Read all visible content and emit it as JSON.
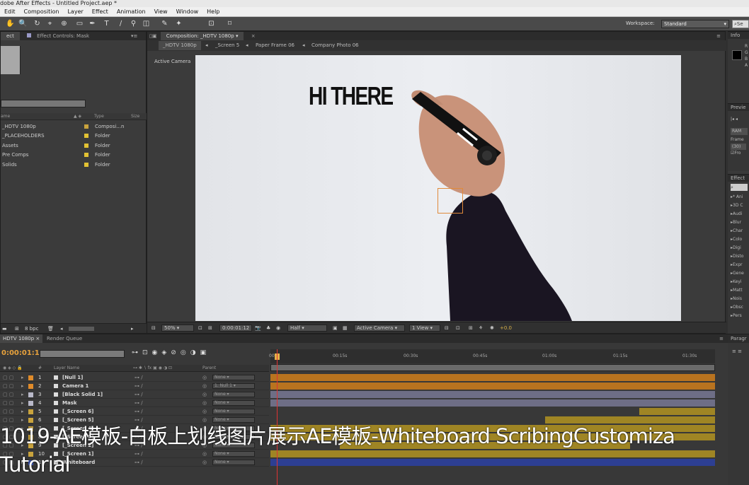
{
  "window": {
    "title": "dobe After Effects - Untitled Project.aep *"
  },
  "menu": [
    "Edit",
    "Composition",
    "Layer",
    "Effect",
    "Animation",
    "View",
    "Window",
    "Help"
  ],
  "toolbar": {
    "workspace_label": "Workspace:",
    "workspace_value": "Standard",
    "search_placeholder": "Se"
  },
  "project_panel": {
    "tabs": [
      "ect",
      "Effect Controls: Mask"
    ],
    "columns": [
      "ame",
      "Type",
      "Size"
    ],
    "items": [
      {
        "name": "_HDTV 1080p",
        "type": "Composi...n",
        "color": "#c9a33d"
      },
      {
        "name": "_PLACEHOLDERS",
        "type": "Folder",
        "color": "#e2c233"
      },
      {
        "name": "Assets",
        "type": "Folder",
        "color": "#e2c233"
      },
      {
        "name": "Pre Comps",
        "type": "Folder",
        "color": "#e2c233"
      },
      {
        "name": "Solids",
        "type": "Folder",
        "color": "#e2c233"
      }
    ],
    "bpc": "8 bpc"
  },
  "comp_panel": {
    "tab": "Composition: _HDTV 1080p",
    "breadcrumbs": [
      "_HDTV 1080p",
      "_Screen 5",
      "Paper Frame 06",
      "Company Photo 06"
    ],
    "view_label": "Active Camera",
    "canvas_text": "HI THERE",
    "zoom": "50%",
    "timecode": "0:00:01:12",
    "resolution": "Half",
    "camera": "Active Camera",
    "views": "1 View",
    "exposure": "+0.0"
  },
  "right_panels": {
    "info": {
      "title": "Info",
      "lines": [
        "R",
        "G",
        "B",
        "A"
      ]
    },
    "preview": {
      "title": "Previe",
      "ram": "RAM",
      "frame_label": "Frame",
      "frame_value": "(30)",
      "from_label": "Fro"
    },
    "effects": {
      "title": "Effect",
      "items": [
        "* Ani",
        "3D C",
        "Audi",
        "Blur",
        "Char",
        "Colo",
        "Digi",
        "Disto",
        "Expr",
        "Gene",
        "Keyi",
        "Matt",
        "Nois",
        "Obsc",
        "Pers"
      ]
    },
    "paragraph": {
      "title": "Paragr"
    }
  },
  "timeline": {
    "tabs": [
      "HDTV 1080p",
      "Render Queue"
    ],
    "current_time": "0:00:01:12",
    "columns": [
      "#",
      "Layer Name",
      "Parent"
    ],
    "ruler": [
      "00s",
      "00:15s",
      "00:30s",
      "00:45s",
      "01:00s",
      "01:15s",
      "01:30s"
    ],
    "layers": [
      {
        "num": "1",
        "name": "[Null 1]",
        "parent": "None",
        "color": "#e08b2a"
      },
      {
        "num": "2",
        "name": "Camera 1",
        "parent": "1. Null 1",
        "color": "#e08b2a"
      },
      {
        "num": "3",
        "name": "[Black Solid 1]",
        "parent": "None",
        "color": "#b9b9c9"
      },
      {
        "num": "4",
        "name": "Mask",
        "parent": "None",
        "color": "#b9b9c9"
      },
      {
        "num": "5",
        "name": "[_Screen 6]",
        "parent": "None",
        "color": "#c9a33d"
      },
      {
        "num": "6",
        "name": "[_Screen 5]",
        "parent": "None",
        "color": "#c9a33d"
      },
      {
        "num": "7",
        "name": "[_Screen 4]",
        "parent": "None",
        "color": "#c9a33d"
      },
      {
        "num": "8",
        "name": "[_Screen 3]",
        "parent": "None",
        "color": "#c9a33d"
      },
      {
        "num": "9",
        "name": "[_Screen 2]",
        "parent": "None",
        "color": "#c9a33d"
      },
      {
        "num": "10",
        "name": "[_Screen 1]",
        "parent": "None",
        "color": "#c9a33d"
      },
      {
        "num": "11",
        "name": "Whiteboard",
        "parent": "None",
        "color": "#3a56b8"
      }
    ]
  },
  "caption": {
    "line1": "1019-AE模板-白板上划线图片展示AE模板-Whiteboard ScribingCustomiza",
    "line2": "Tutorial"
  }
}
